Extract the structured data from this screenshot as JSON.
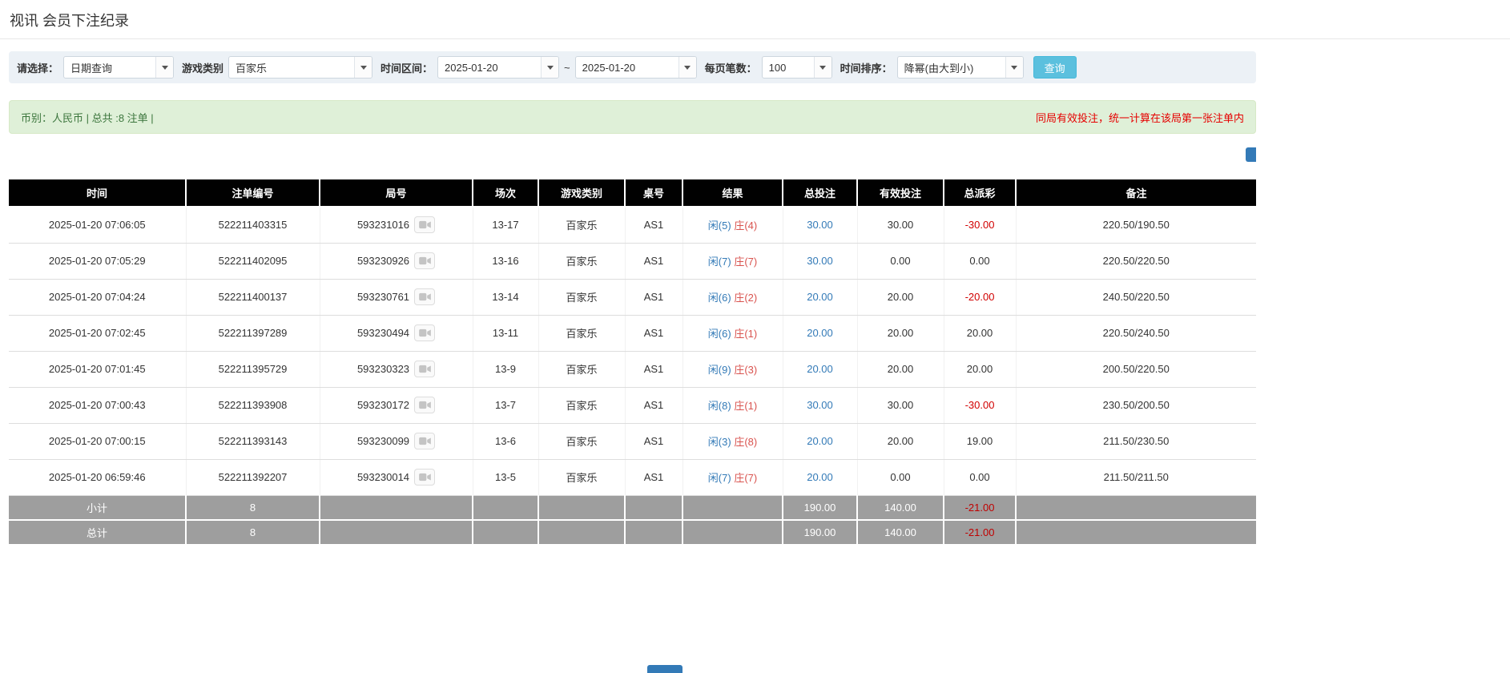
{
  "page": {
    "title": "视讯 会员下注纪录"
  },
  "filters": {
    "select_label": "请选择：",
    "select_value": "日期查询",
    "game_type_label": "游戏类别",
    "game_type_value": "百家乐",
    "date_range_label": "时间区间：",
    "date_from": "2025-01-20",
    "date_tilde": "~",
    "date_to": "2025-01-20",
    "page_size_label": "每页笔数：",
    "page_size_value": "100",
    "sort_label": "时间排序：",
    "sort_value": "降幂(由大到小)",
    "search_button": "查询"
  },
  "summary": {
    "left": "币别：人民币 | 总共 :8 注单 |",
    "right": "同局有效投注，统一计算在该局第一张注单内"
  },
  "table": {
    "headers": [
      "时间",
      "注单编号",
      "局号",
      "场次",
      "游戏类别",
      "桌号",
      "结果",
      "总投注",
      "有效投注",
      "总派彩",
      "备注"
    ],
    "rows": [
      {
        "time": "2025-01-20 07:06:05",
        "bet_id": "522211403315",
        "round_no": "593231016",
        "session": "13-17",
        "game": "百家乐",
        "table_no": "AS1",
        "result_player": "闲(5)",
        "result_banker": "庄(4)",
        "total_bet": "30.00",
        "valid_bet": "30.00",
        "payout": "-30.00",
        "note": "220.50/190.50"
      },
      {
        "time": "2025-01-20 07:05:29",
        "bet_id": "522211402095",
        "round_no": "593230926",
        "session": "13-16",
        "game": "百家乐",
        "table_no": "AS1",
        "result_player": "闲(7)",
        "result_banker": "庄(7)",
        "total_bet": "30.00",
        "valid_bet": "0.00",
        "payout": "0.00",
        "note": "220.50/220.50"
      },
      {
        "time": "2025-01-20 07:04:24",
        "bet_id": "522211400137",
        "round_no": "593230761",
        "session": "13-14",
        "game": "百家乐",
        "table_no": "AS1",
        "result_player": "闲(6)",
        "result_banker": "庄(2)",
        "total_bet": "20.00",
        "valid_bet": "20.00",
        "payout": "-20.00",
        "note": "240.50/220.50"
      },
      {
        "time": "2025-01-20 07:02:45",
        "bet_id": "522211397289",
        "round_no": "593230494",
        "session": "13-11",
        "game": "百家乐",
        "table_no": "AS1",
        "result_player": "闲(6)",
        "result_banker": "庄(1)",
        "total_bet": "20.00",
        "valid_bet": "20.00",
        "payout": "20.00",
        "note": "220.50/240.50"
      },
      {
        "time": "2025-01-20 07:01:45",
        "bet_id": "522211395729",
        "round_no": "593230323",
        "session": "13-9",
        "game": "百家乐",
        "table_no": "AS1",
        "result_player": "闲(9)",
        "result_banker": "庄(3)",
        "total_bet": "20.00",
        "valid_bet": "20.00",
        "payout": "20.00",
        "note": "200.50/220.50"
      },
      {
        "time": "2025-01-20 07:00:43",
        "bet_id": "522211393908",
        "round_no": "593230172",
        "session": "13-7",
        "game": "百家乐",
        "table_no": "AS1",
        "result_player": "闲(8)",
        "result_banker": "庄(1)",
        "total_bet": "30.00",
        "valid_bet": "30.00",
        "payout": "-30.00",
        "note": "230.50/200.50"
      },
      {
        "time": "2025-01-20 07:00:15",
        "bet_id": "522211393143",
        "round_no": "593230099",
        "session": "13-6",
        "game": "百家乐",
        "table_no": "AS1",
        "result_player": "闲(3)",
        "result_banker": "庄(8)",
        "total_bet": "20.00",
        "valid_bet": "20.00",
        "payout": "19.00",
        "note": "211.50/230.50"
      },
      {
        "time": "2025-01-20 06:59:46",
        "bet_id": "522211392207",
        "round_no": "593230014",
        "session": "13-5",
        "game": "百家乐",
        "table_no": "AS1",
        "result_player": "闲(7)",
        "result_banker": "庄(7)",
        "total_bet": "20.00",
        "valid_bet": "0.00",
        "payout": "0.00",
        "note": "211.50/211.50"
      }
    ],
    "subtotal": {
      "label": "小计",
      "count": "8",
      "total_bet": "190.00",
      "valid_bet": "140.00",
      "payout": "-21.00"
    },
    "total": {
      "label": "总计",
      "count": "8",
      "total_bet": "190.00",
      "valid_bet": "140.00",
      "payout": "-21.00"
    }
  }
}
